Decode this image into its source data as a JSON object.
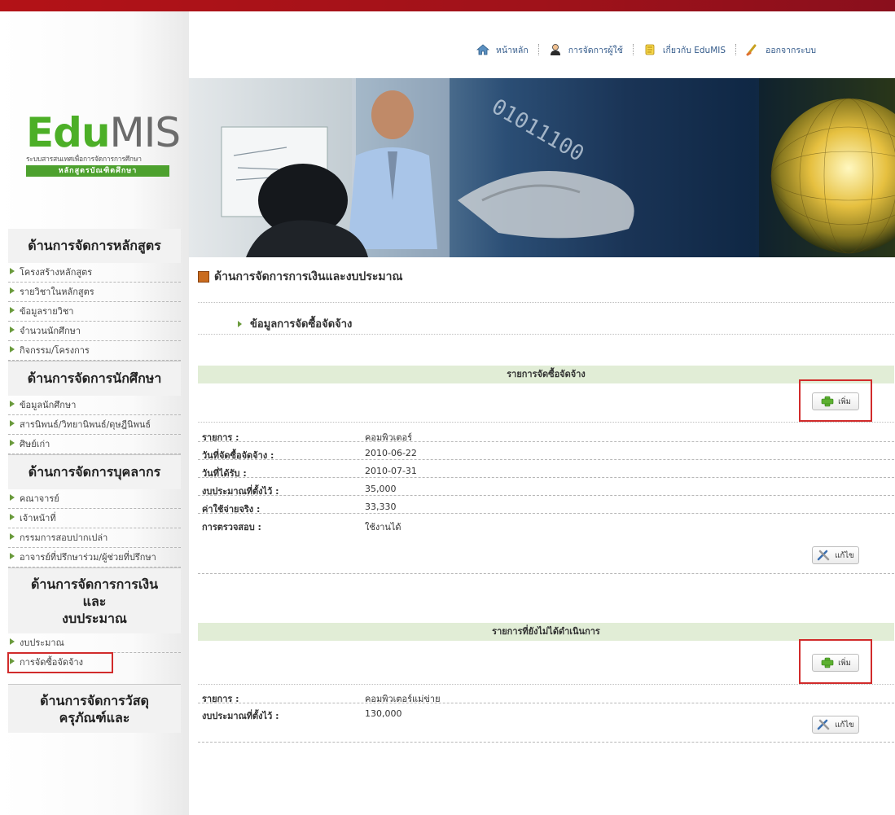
{
  "topnav": {
    "home": "หน้าหลัก",
    "users": "การจัดการผู้ใช้",
    "about": "เกี่ยวกับ EduMIS",
    "logout": "ออกจากระบบ"
  },
  "logo": {
    "edu": "Edu",
    "mis": "MIS",
    "subtitle": "ระบบสารสนเทศเพื่อการจัดการการศึกษา",
    "bar": "หลักสูตรบัณฑิตศึกษา"
  },
  "sidebar": {
    "sections": [
      {
        "title": "ด้านการจัดการหลักสูตร",
        "items": [
          "โครงสร้างหลักสูตร",
          "รายวิชาในหลักสูตร",
          "ข้อมูลรายวิชา",
          "จำนวนนักศึกษา",
          "กิจกรรม/โครงการ"
        ]
      },
      {
        "title": "ด้านการจัดการนักศึกษา",
        "items": [
          "ข้อมูลนักศึกษา",
          "สารนิพนธ์/วิทยานิพนธ์/ดุษฎีนิพนธ์",
          "ศิษย์เก่า"
        ]
      },
      {
        "title": "ด้านการจัดการบุคลากร",
        "items": [
          "คณาจารย์",
          "เจ้าหน้าที่",
          "กรรมการสอบปากเปล่า",
          "อาจารย์ที่ปรึกษาร่วม/ผู้ช่วยที่ปรึกษา"
        ]
      },
      {
        "title_line1": "ด้านการจัดการการเงิน",
        "title_line2": "และ",
        "title_line3": "งบประมาณ",
        "items": [
          "งบประมาณ",
          "การจัดซื้อจัดจ้าง"
        ]
      },
      {
        "title_line1": "ด้านการจัดการวัสดุ",
        "title_line2": "ครุภัณฑ์และ"
      }
    ]
  },
  "main": {
    "title": "ด้านการจัดการการเงินและงบประมาณ",
    "subtitle": "ข้อมูลการจัดซื้อจัดจ้าง",
    "add_label": "เพิ่ม",
    "edit_label": "แก้ไข",
    "section1": {
      "header": "รายการจัดซื้อจัดจ้าง",
      "rows": [
        {
          "label": "รายการ :",
          "value": "คอมพิวเตอร์"
        },
        {
          "label": "วันที่จัดซื้อจัดจ้าง :",
          "value": "2010-06-22"
        },
        {
          "label": "วันที่ได้รับ :",
          "value": "2010-07-31"
        },
        {
          "label": "งบประมาณที่ตั้งไว้ :",
          "value": "35,000"
        },
        {
          "label": "ค่าใช้จ่ายจริง :",
          "value": "33,330"
        },
        {
          "label": "การตรวจสอบ :",
          "value": "ใช้งานได้"
        }
      ]
    },
    "section2": {
      "header": "รายการที่ยังไม่ได้ดำเนินการ",
      "rows": [
        {
          "label": "รายการ :",
          "value": "คอมพิวเตอร์แม่ข่าย"
        },
        {
          "label": "งบประมาณที่ตั้งไว้ :",
          "value": "130,000"
        }
      ]
    }
  }
}
